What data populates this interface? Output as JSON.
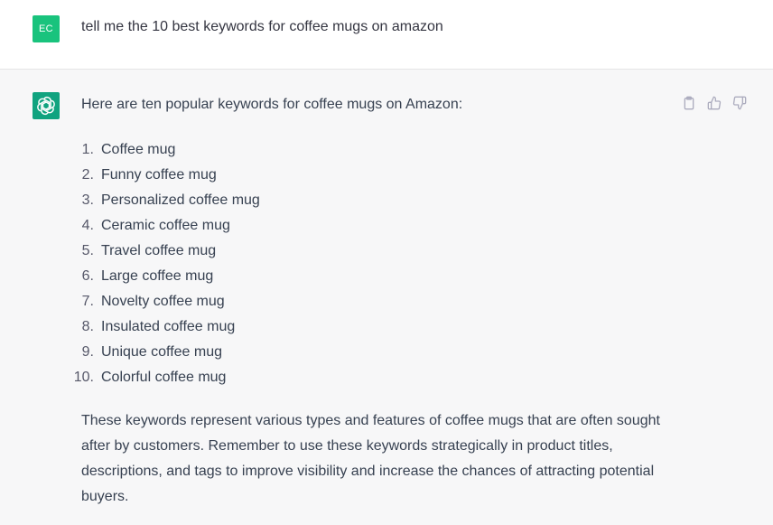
{
  "user": {
    "avatar_initials": "EC",
    "avatar_color": "#19c37d",
    "message": "tell me the 10 best keywords for coffee mugs on amazon"
  },
  "assistant": {
    "avatar_color": "#10a37f",
    "avatar_icon": "openai-logo-icon",
    "intro": "Here are ten popular keywords for coffee mugs on Amazon:",
    "keywords": [
      {
        "num": "1.",
        "text": "Coffee mug"
      },
      {
        "num": "2.",
        "text": "Funny coffee mug"
      },
      {
        "num": "3.",
        "text": "Personalized coffee mug"
      },
      {
        "num": "4.",
        "text": "Ceramic coffee mug"
      },
      {
        "num": "5.",
        "text": "Travel coffee mug"
      },
      {
        "num": "6.",
        "text": "Large coffee mug"
      },
      {
        "num": "7.",
        "text": "Novelty coffee mug"
      },
      {
        "num": "8.",
        "text": "Insulated coffee mug"
      },
      {
        "num": "9.",
        "text": "Unique coffee mug"
      },
      {
        "num": "10.",
        "text": "Colorful coffee mug"
      }
    ],
    "outro": "These keywords represent various types and features of coffee mugs that are often sought after by customers. Remember to use these keywords strategically in product titles, descriptions, and tags to improve visibility and increase the chances of attracting potential buyers.",
    "actions": [
      "clipboard-icon",
      "thumbs-up-icon",
      "thumbs-down-icon"
    ]
  }
}
